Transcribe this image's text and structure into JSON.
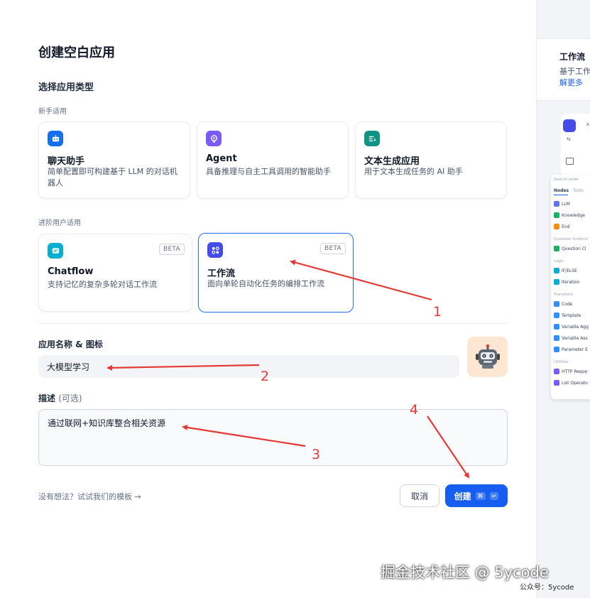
{
  "dialog": {
    "title": "创建空白应用",
    "section_title": "选择应用类型",
    "groups": {
      "beginner": "新手适用",
      "advanced": "进阶用户适用"
    },
    "cards": [
      {
        "name": "聊天助手",
        "desc": "简单配置即可构建基于 LLM 的对话机器人",
        "color": "#1570ef",
        "icon": "chat-bot-icon"
      },
      {
        "name": "Agent",
        "desc": "具备推理与自主工具调用的智能助手",
        "color": "#7a5af8",
        "icon": "agent-icon"
      },
      {
        "name": "文本生成应用",
        "desc": "用于文本生成任务的 AI 助手",
        "color": "#0e9384",
        "icon": "text-generate-icon"
      },
      {
        "name": "Chatflow",
        "desc": "支持记忆的复杂多轮对话工作流",
        "badge": "BETA",
        "color": "#06aed4",
        "icon": "chatflow-icon"
      },
      {
        "name": "工作流",
        "desc": "面向单轮自动化任务的编排工作流",
        "badge": "BETA",
        "color": "#444ce7",
        "icon": "workflow-icon",
        "selected": true
      }
    ],
    "name_label": "应用名称 & 图标",
    "name_value": "大模型学习",
    "desc_label": "描述",
    "desc_optional": "(可选)",
    "desc_value": "通过联网+知识库整合相关资源",
    "template_link": "没有想法？试试我们的模板 →",
    "cancel_label": "取消",
    "create_label": "创建",
    "create_shortcut_1": "⌘",
    "create_shortcut_2": "↵",
    "accent_color": "#155eef"
  },
  "preview": {
    "title": "工作流",
    "subtitle": "基于工作",
    "more": "解更多",
    "canvas_label": "A",
    "search_placeholder": "Search node",
    "tabs": [
      "Nodes",
      "Tools"
    ],
    "groups": [
      {
        "name": "",
        "items": [
          {
            "label": "LLM",
            "color": "#6172f3"
          },
          {
            "label": "Knowledge",
            "color": "#16b364"
          },
          {
            "label": "End",
            "color": "#f79009"
          }
        ]
      },
      {
        "name": "Question Underst",
        "items": [
          {
            "label": "Question Cl",
            "color": "#16b364"
          }
        ]
      },
      {
        "name": "Logic",
        "items": [
          {
            "label": "IF/ELSE",
            "color": "#06aed4"
          },
          {
            "label": "Iteration",
            "color": "#06aed4"
          }
        ]
      },
      {
        "name": "Transform",
        "items": [
          {
            "label": "Code",
            "color": "#2e90fa"
          },
          {
            "label": "Template",
            "color": "#2e90fa"
          },
          {
            "label": "Variable Agg",
            "color": "#2e90fa"
          },
          {
            "label": "Variable Ass",
            "color": "#2e90fa"
          },
          {
            "label": "Parameter E",
            "color": "#2e90fa"
          }
        ]
      },
      {
        "name": "Utilities",
        "items": [
          {
            "label": "HTTP Reque",
            "color": "#7a5af8"
          },
          {
            "label": "List Operato",
            "color": "#7a5af8"
          }
        ]
      }
    ]
  },
  "annotations": [
    "1",
    "2",
    "3",
    "4"
  ],
  "watermark": {
    "main": "掘金技术社区 @ 5ycode",
    "sub": "公众号：5ycode"
  }
}
